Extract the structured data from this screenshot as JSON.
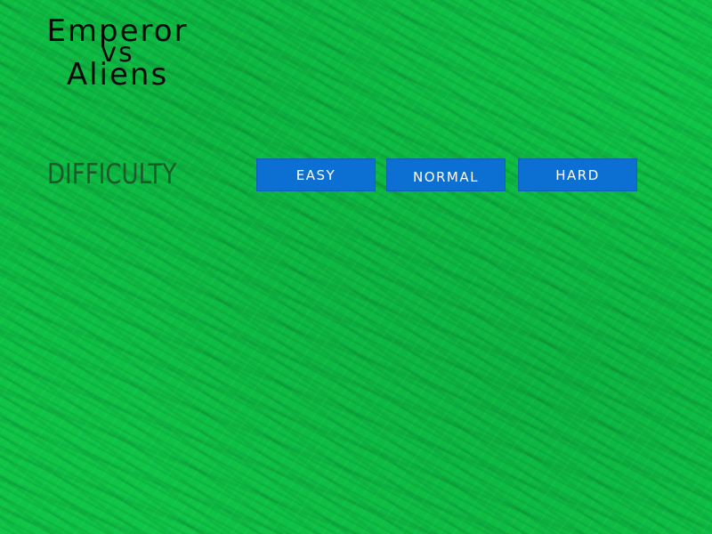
{
  "game": {
    "title_line1": "Emperor",
    "title_line2": "vs",
    "title_line3": "Aliens"
  },
  "menu": {
    "difficulty_label": "DIFFICULTY",
    "easy_label": "EASY",
    "normal_label": "NORMAL",
    "hard_label": "HARD"
  },
  "colors": {
    "background": "#0fc447",
    "button": "#0c6fd2",
    "button_text": "#ffffff",
    "label_text": "#1b5a2c",
    "title_text": "#050805"
  }
}
